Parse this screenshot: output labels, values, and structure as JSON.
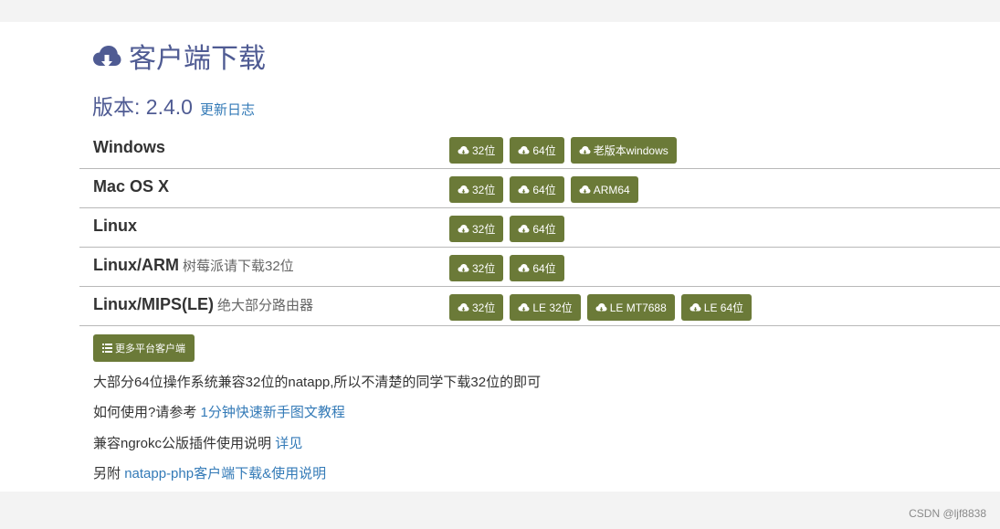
{
  "page": {
    "title": "客户端下载",
    "version_label": "版本: 2.4.0",
    "changelog_link": "更新日志",
    "title_icon": "cloud-download-icon",
    "accent_color": "#4f5b93",
    "button_color": "#6b7a38",
    "link_color": "#337ab7"
  },
  "platforms": [
    {
      "name": "Windows",
      "note": "",
      "buttons": [
        "32位",
        "64位",
        "老版本windows"
      ]
    },
    {
      "name": "Mac OS X",
      "note": "",
      "buttons": [
        "32位",
        "64位",
        "ARM64"
      ]
    },
    {
      "name": "Linux",
      "note": "",
      "buttons": [
        "32位",
        "64位"
      ]
    },
    {
      "name": "Linux/ARM",
      "note": "树莓派请下载32位",
      "buttons": [
        "32位",
        "64位"
      ]
    },
    {
      "name": "Linux/MIPS(LE)",
      "note": "绝大部分路由器",
      "buttons": [
        "32位",
        "LE 32位",
        "LE MT7688",
        "LE 64位"
      ]
    }
  ],
  "more_button": "更多平台客户端",
  "info": {
    "line1": "大部分64位操作系统兼容32位的natapp,所以不清楚的同学下载32位的即可",
    "line2_prefix": "如何使用?请参考",
    "line2_link": "1分钟快速新手图文教程",
    "line3_prefix": "兼容ngrokc公版插件使用说明",
    "line3_link": "详见",
    "line4_prefix": "另附",
    "line4_link": "natapp-php客户端下载&使用说明"
  },
  "watermark": "CSDN @ljf8838"
}
